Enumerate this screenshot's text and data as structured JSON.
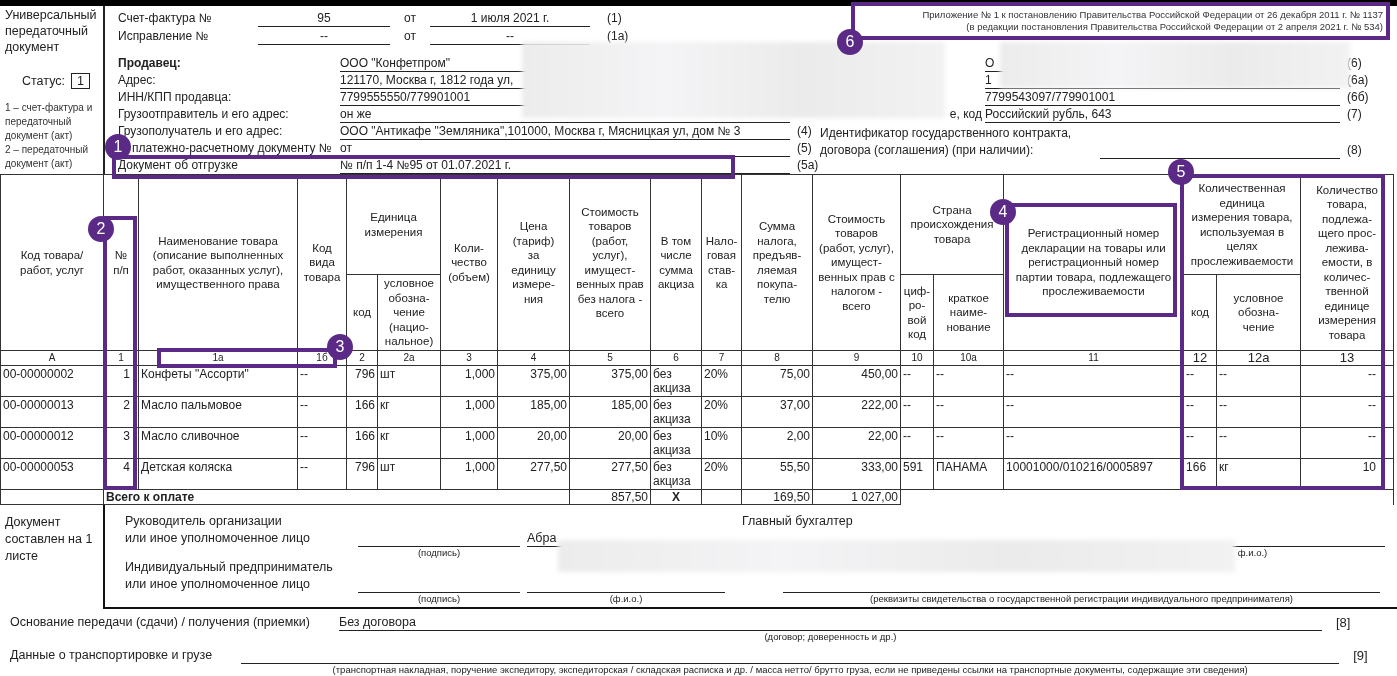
{
  "appendix_note": [
    "Приложение № 1 к постановлению Правительства Российской Федерации от 26 декабря 2011 г. № 1137",
    "(в редакции постановления Правительства Российской Федерации от 2 апреля 2021 г. № 534)"
  ],
  "document_title": "Универсальный передаточный документ",
  "status": {
    "label": "Статус:",
    "value": "1"
  },
  "status_legend": [
    "1 – счет-фактура и передаточный документ (акт)",
    "2 – передаточный документ (акт)"
  ],
  "invoice": [
    {
      "label": "Счет-фактура №",
      "number": "95",
      "from": "от",
      "date": "1 июля 2021 г.",
      "ref": "(1)"
    },
    {
      "label": "Исправление №",
      "number": "--",
      "from": "от",
      "date": "--",
      "ref": "(1а)"
    }
  ],
  "seller_fields": [
    {
      "label": "Продавец:",
      "value": "ООО \"Конфетпром\"",
      "bold": true
    },
    {
      "label": "Адрес:",
      "value": "121170, Москва г, 1812 года ул,",
      "bold": false
    },
    {
      "label": "ИНН/КПП продавца:",
      "value": "7799555550/779901001",
      "bold": false
    },
    {
      "label": "Грузоотправитель и его адрес:",
      "value": "он же",
      "bold": false
    },
    {
      "label": "Грузополучатель и его адрес:",
      "value": "ООО \"Антикафе \"Земляника\",101000, Москва г, Мясницкая ул, дом № 3",
      "ref": "(4)",
      "bold": false
    },
    {
      "label": "платежно-расчетному документу №",
      "value": "от",
      "ref": "(5)",
      "bold": false
    },
    {
      "label": "Документ об отгрузке",
      "value": "№ п/п 1-4 №95 от 01.07.2021 г.",
      "ref": "(5а)",
      "bold": false
    }
  ],
  "buyer_fields": [
    {
      "value": "О",
      "ref": "(6)"
    },
    {
      "value": "1",
      "ref": "(6а)"
    },
    {
      "value": "7799543097/779901001",
      "ref": "(6б)"
    },
    {
      "label": "е, код",
      "value": "Российский рубль, 643",
      "ref": "(7)"
    }
  ],
  "contract_id": {
    "label": "Идентификатор государственного контракта,\nдоговора (соглашения) (при наличии):",
    "ref": "(8)"
  },
  "table": {
    "columns": [
      {
        "title": "Код товара/\nработ, услуг"
      },
      {
        "title": "№\nп/п"
      },
      {
        "title": "Наименование товара\n(описание выполненных\nработ, оказанных услуг),\nимущественного права"
      },
      {
        "title": "Код\nвида\nтовара"
      },
      {
        "title": "Единица\nизмерения",
        "colspan": 2,
        "sub": [
          "код",
          "условное\nобозна-\nчение\n(нацио-\nнальное)"
        ]
      },
      {
        "title": "Коли-\nчество\n(объем)"
      },
      {
        "title": "Цена\n(тариф)\nза\nединицу\nизмере-\nния"
      },
      {
        "title": "Стоимость\nтоваров\n(работ,\nуслуг),\nимущест-\nвенных прав\nбез налога -\nвсего"
      },
      {
        "title": "В том\nчисле\nсумма\nакциза"
      },
      {
        "title": "Нало-\nговая\nстав-\nка"
      },
      {
        "title": "Сумма\nналога,\nпредъяв-\nляемая\nпокупа-\nтелю"
      },
      {
        "title": "Стоимость\nтоваров\n(работ, услуг),\nимущест-\nвенных прав с\nналогом -\nвсего"
      },
      {
        "title": "Страна\nпроисхождения\nтовара",
        "colspan": 2,
        "sub": [
          "циф-\nро-\nвой\nкод",
          "краткое\nнаиме-\nнование"
        ]
      },
      {
        "title": "Регистрационный номер\nдекларации на товары или\nрегистрационный номер\nпартии товара, подлежащего\nпрослеживаемости"
      },
      {
        "title": "Количественная\nединица\nизмерения товара,\nиспользуемая в\nцелях\nпрослеживаемости",
        "colspan": 2,
        "sub": [
          "код",
          "условное\nобозна-\nчение"
        ]
      },
      {
        "title": "Количество\nтовара,\nподлежа-\nщего прос-\nлежива-\nемости, в\nколичес-\nтвенной\nединице\nизмерения\nтовара"
      }
    ],
    "column_numbers": [
      "А",
      "1",
      "1а",
      "1б",
      "2",
      "2а",
      "3",
      "4",
      "5",
      "6",
      "7",
      "8",
      "9",
      "10",
      "10а",
      "11",
      "12",
      "12а",
      "13"
    ],
    "rows": [
      [
        "00-00000002",
        "1",
        "Конфеты \"Ассорти\"",
        "--",
        "796",
        "шт",
        "1,000",
        "375,00",
        "375,00",
        "без акциза",
        "20%",
        "75,00",
        "450,00",
        "--",
        "--",
        "--",
        "--",
        "--",
        "--"
      ],
      [
        "00-00000013",
        "2",
        "Масло пальмовое",
        "--",
        "166",
        "кг",
        "1,000",
        "185,00",
        "185,00",
        "без акциза",
        "20%",
        "37,00",
        "222,00",
        "--",
        "--",
        "--",
        "--",
        "--",
        "--"
      ],
      [
        "00-00000012",
        "3",
        "Масло сливочное",
        "--",
        "166",
        "кг",
        "1,000",
        "20,00",
        "20,00",
        "без акциза",
        "10%",
        "2,00",
        "22,00",
        "--",
        "--",
        "--",
        "--",
        "--",
        "--"
      ],
      [
        "00-00000053",
        "4",
        "Детская коляска",
        "--",
        "796",
        "шт",
        "1,000",
        "277,50",
        "277,50",
        "без акциза",
        "20%",
        "55,50",
        "333,00",
        "591",
        "ПАНАМА",
        "10001000/010216/0005897",
        "166",
        "кг",
        "10"
      ]
    ],
    "totals": {
      "label": "Всего к оплате",
      "cost_without_tax": "857,50",
      "excise": "X",
      "tax": "169,50",
      "cost_with_tax": "1 027,00"
    }
  },
  "sheets_note": "Документ составлен на 1 листе",
  "signatures": {
    "head_label": "Руководитель организации\nили иное уполномоченное лицо",
    "head_name": "Абра",
    "head_sign_caption": "(подпись)",
    "chief_label": "Главный бухгалтер",
    "chief_name_caption": "ф.и.о.)",
    "entrepreneur_label": "Индивидуальный предприниматель\nили иное уполномоченное лицо",
    "entrepreneur_sign_caption": "(подпись)",
    "entrepreneur_name_caption": "(ф.и.о.)",
    "registration_caption": "(реквизиты свидетельства о государственной  регистрации индивидуального предпринимателя)"
  },
  "basis": {
    "label": "Основание передачи (сдачи) / получения (приемки)",
    "value": "Без договора",
    "ref": "[8]",
    "caption": "(договор; доверенность и др.)"
  },
  "transport": {
    "label": "Данные о транспортировке и грузе",
    "ref": "[9]",
    "caption": "(транспортная накладная, поручение экспедитору, экспедиторская / складская расписка и др. / масса нетто/ брутто груза, если не приведены ссылки на транспортные документы, содержащие эти сведения)"
  },
  "callouts": [
    {
      "number": "1"
    },
    {
      "number": "2"
    },
    {
      "number": "3"
    },
    {
      "number": "4"
    },
    {
      "number": "5"
    },
    {
      "number": "6"
    }
  ]
}
